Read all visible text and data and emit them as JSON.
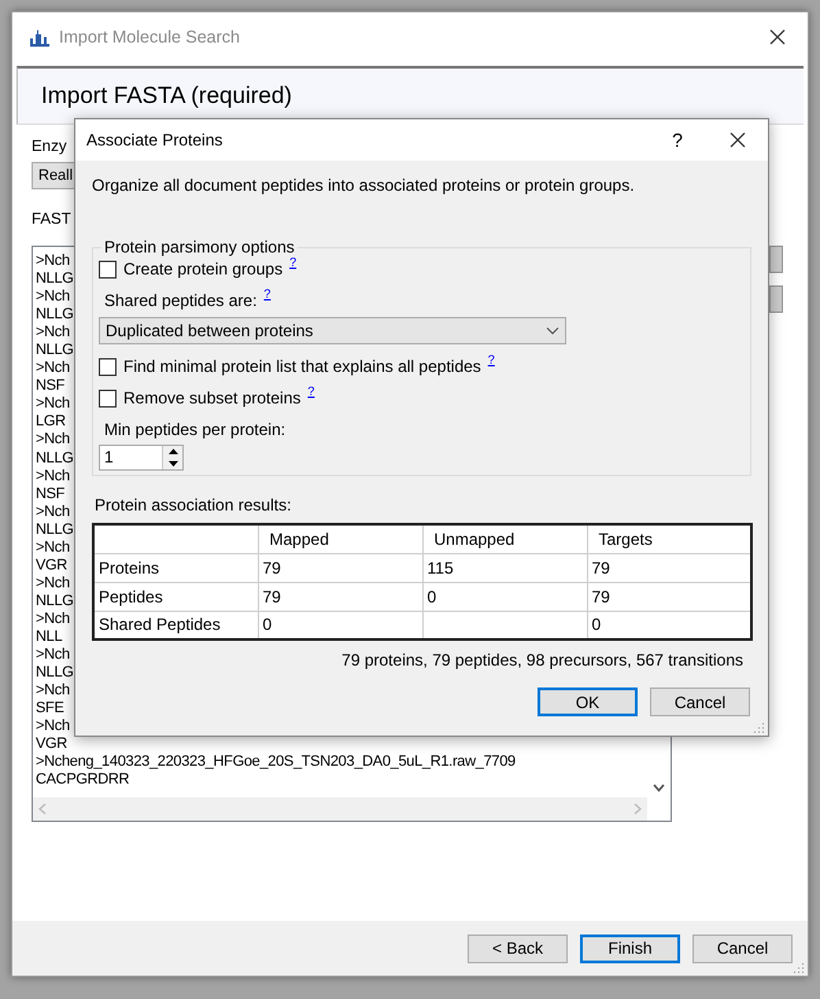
{
  "window": {
    "title": "Import Molecule Search"
  },
  "page_header": {
    "title": "Import FASTA (required)"
  },
  "enzyme": {
    "label": "Enzy",
    "value": "Reall"
  },
  "fasta": {
    "label": "FAST",
    "lines": [
      ">Nch",
      "NLLG",
      ">Nch",
      "NLLG",
      ">Nch",
      "NLLG",
      ">Nch",
      "NSF",
      ">Nch",
      "LGR",
      ">Nch",
      "NLLG",
      ">Nch",
      "NSF",
      ">Nch",
      "NLLG",
      ">Nch",
      "VGR",
      ">Nch",
      "NLLG",
      ">Nch",
      "NLL",
      ">Nch",
      "NLLG",
      ">Nch",
      "SFE",
      ">Nch",
      "VGR",
      ">Ncheng_140323_220323_HFGoe_20S_TSN203_DA0_5uL_R1.raw_7709",
      "CACPGRDRR"
    ]
  },
  "wizard_buttons": [
    {
      "label": "< Back",
      "default": false
    },
    {
      "label": "Finish",
      "default": true
    },
    {
      "label": "Cancel",
      "default": false
    }
  ],
  "dialog": {
    "title": "Associate Proteins",
    "help": "?",
    "description": "Organize all document peptides into associated proteins or protein groups.",
    "parsimony": {
      "legend": "Protein parsimony options",
      "options": [
        {
          "kind": "checkbox",
          "label": "Create protein groups",
          "help": "?",
          "checked": false
        },
        {
          "kind": "label",
          "label": "Shared peptides are:",
          "help": "?"
        },
        {
          "kind": "dropdown",
          "value": "Duplicated between proteins"
        },
        {
          "kind": "checkbox",
          "label": "Find minimal protein list that explains all peptides",
          "help": "?",
          "checked": false
        },
        {
          "kind": "checkbox",
          "label": "Remove subset proteins",
          "help": "?",
          "checked": false
        },
        {
          "kind": "spinner",
          "label": "Min peptides per protein:",
          "value": "1"
        }
      ]
    },
    "results": {
      "label": "Protein association results:",
      "columns": [
        "Mapped",
        "Unmapped",
        "Targets"
      ],
      "rows": [
        {
          "name": "Proteins",
          "cells": [
            "79",
            "115",
            "79"
          ]
        },
        {
          "name": "Peptides",
          "cells": [
            "79",
            "0",
            "79"
          ]
        },
        {
          "name": "Shared Peptides",
          "cells": [
            "0",
            null,
            "0"
          ]
        }
      ],
      "summary": "79 proteins, 79 peptides, 98 precursors, 567 transitions"
    },
    "buttons": [
      {
        "label": "OK",
        "default": true
      },
      {
        "label": "Cancel",
        "default": false
      }
    ]
  }
}
